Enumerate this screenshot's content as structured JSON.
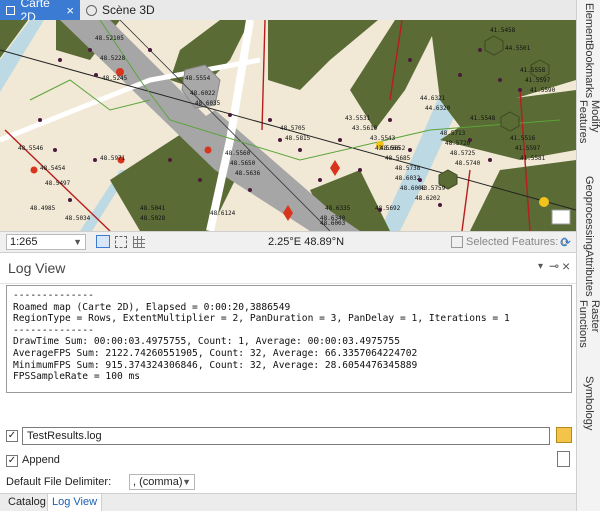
{
  "tabs": [
    {
      "label": "Carte 2D",
      "close": "×"
    },
    {
      "label": "Scène 3D"
    }
  ],
  "map": {
    "scale": "1:265",
    "coordinates": "2.25°E 48.89°N",
    "selected_features": "Selected Features: 0",
    "labels": [
      "48.52105",
      "48.5228",
      "48.5245",
      "48.5971",
      "48.5546",
      "41.5458",
      "48.5554",
      "48.6022",
      "48.6035",
      "48.5454",
      "48.5497",
      "41.5548",
      "43.5531",
      "43.5610",
      "48.5560",
      "48.5650",
      "48.5636",
      "48.5705",
      "48.5815",
      "48.6340",
      "48.6335",
      "44.5501",
      "48.5652",
      "48.5685",
      "48.5738",
      "48.6032",
      "48.6008",
      "48.5692",
      "43.5543",
      "43.5666",
      "43.5759",
      "48.6202",
      "48.5713",
      "48.5720",
      "48.5725",
      "48.5740",
      "41.5558",
      "41.5597",
      "41.5590",
      "41.5516",
      "41.5597",
      "41.5581",
      "44.6321",
      "44.6320",
      "48.4985",
      "48.5034",
      "48.5041",
      "48.5028",
      "48.6003",
      "48.6124"
    ]
  },
  "sidebar": [
    "Element",
    "Bookmarks",
    "Modify Features",
    "Geoprocessing",
    "Attributes",
    "Raster Functions",
    "Symbology"
  ],
  "log_view": {
    "title": "Log View",
    "pin": "⊸",
    "close": "×",
    "menu": "▾",
    "log_lines": [
      "--------------",
      "Roamed map (Carte 2D), Elapsed = 0:00:20,3886549",
      "RegionType = Rows, ExtentMultiplier = 2, PanDuration = 3, PanDelay = 1, Iterations = 1",
      "--------------",
      "DrawTime Sum: 00:00:03.4975755, Count: 1, Average: 00:00:03.4975755",
      "AverageFPS Sum: 2122.74260551905, Count: 32, Average: 66.3357064224702",
      "MinimumFPS Sum: 915.374324306846, Count: 32, Average: 28.6054476345889",
      "FPSSampleRate = 100 ms"
    ],
    "output_checked": true,
    "output_file": "TestResults.log",
    "append_checked": true,
    "append_label": "Append",
    "delimiter_label": "Default File Delimiter:",
    "delimiter_value": ", (comma)"
  },
  "bottom_tabs": [
    "Catalog",
    "Log View"
  ],
  "colors": {
    "accent": "#3b7bd4",
    "vegetation": "#5a6b35",
    "road": "#a6a6a6",
    "water": "#bcd9e4",
    "land": "#f1e9d6"
  }
}
